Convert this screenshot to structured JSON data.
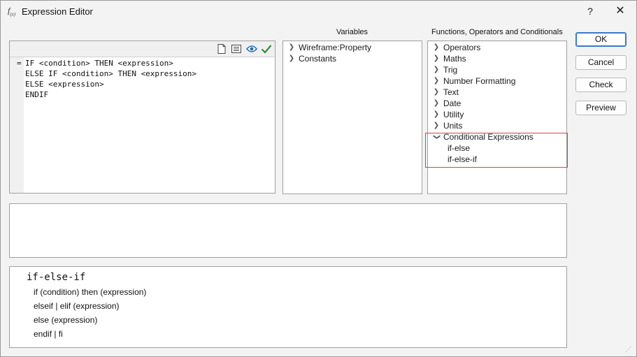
{
  "window": {
    "icon_text": "f",
    "icon_sub": "(x)",
    "title": "Expression Editor",
    "help_label": "?",
    "close_label": "✕"
  },
  "headers": {
    "variables": "Variables",
    "functions": "Functions, Operators and Conditionals"
  },
  "editor": {
    "marker": "=",
    "lines": [
      "IF <condition> THEN <expression>",
      "ELSE IF <condition> THEN <expression>",
      "ELSE <expression>",
      "ENDIF"
    ]
  },
  "variables": {
    "items": [
      {
        "label": "Wireframe:Property"
      },
      {
        "label": "Constants"
      }
    ]
  },
  "functions": {
    "items": [
      {
        "label": "Operators",
        "expanded": false
      },
      {
        "label": "Maths",
        "expanded": false
      },
      {
        "label": "Trig",
        "expanded": false
      },
      {
        "label": "Number Formatting",
        "expanded": false
      },
      {
        "label": "Text",
        "expanded": false
      },
      {
        "label": "Date",
        "expanded": false
      },
      {
        "label": "Utility",
        "expanded": false
      },
      {
        "label": "Units",
        "expanded": false
      },
      {
        "label": "Conditional Expressions",
        "expanded": true
      }
    ],
    "children": [
      {
        "label": "if-else"
      },
      {
        "label": "if-else-if"
      }
    ]
  },
  "buttons": {
    "ok": "OK",
    "cancel": "Cancel",
    "check": "Check",
    "preview": "Preview"
  },
  "help": {
    "title": "if-else-if",
    "lines": [
      "if (condition) then (expression)",
      "elseif | elif (expression)",
      "else (expression)",
      "endif | fi"
    ]
  },
  "colors": {
    "accent": "#3b78c9",
    "highlight": "#d9414c",
    "check": "#2e8b3d",
    "eye": "#1f6fb8"
  }
}
